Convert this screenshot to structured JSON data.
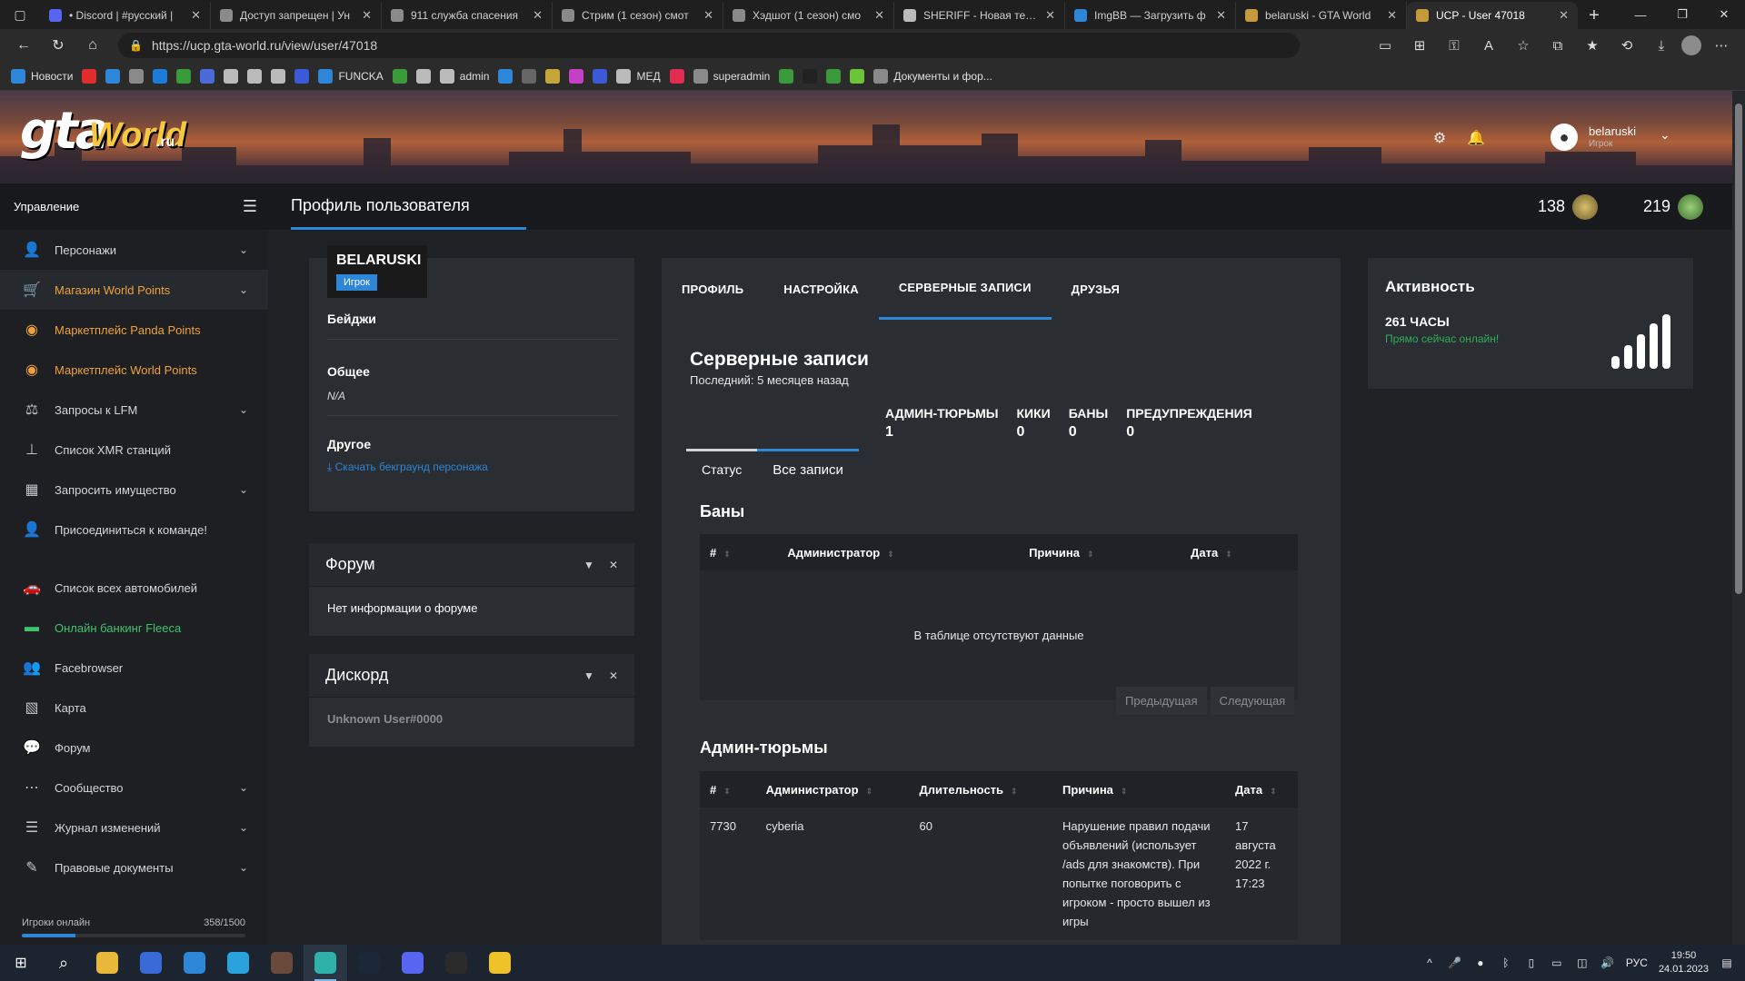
{
  "browser": {
    "tabs": [
      {
        "title": "• Discord | #русский | ",
        "fav": "#5865f2"
      },
      {
        "title": "Доступ запрещен | Ун",
        "fav": "#8a8a8a"
      },
      {
        "title": "911 служба спасения",
        "fav": "#8a8a8a"
      },
      {
        "title": "Стрим (1 сезон) смот",
        "fav": "#8a8a8a"
      },
      {
        "title": "Хэдшот (1 сезон) смо",
        "fav": "#8a8a8a"
      },
      {
        "title": "SHERIFF - Новая тема",
        "fav": "#bbbbbb"
      },
      {
        "title": "ImgBB — Загрузить ф",
        "fav": "#2d86d6"
      },
      {
        "title": "belaruski - GTA World",
        "fav": "#c59a3a"
      },
      {
        "title": "UCP - User 47018",
        "fav": "#c59a3a"
      }
    ],
    "url": "https://ucp.gta-world.ru/view/user/47018",
    "bookmarks": [
      {
        "label": "Новости",
        "color": "#2d86d6"
      },
      {
        "label": "",
        "color": "#e22b2b"
      },
      {
        "label": "",
        "color": "#2d86d6"
      },
      {
        "label": "",
        "color": "#8a8a8a"
      },
      {
        "label": "",
        "color": "#1c7ad8"
      },
      {
        "label": "",
        "color": "#3a9a3a"
      },
      {
        "label": "",
        "color": "#4a6ad8"
      },
      {
        "label": "",
        "color": "#bbbbbb"
      },
      {
        "label": "",
        "color": "#bbbbbb"
      },
      {
        "label": "",
        "color": "#bbbbbb"
      },
      {
        "label": "",
        "color": "#3a5ad8"
      },
      {
        "label": "FUNCKA",
        "color": "#2d86d6"
      },
      {
        "label": "",
        "color": "#3a9a3a"
      },
      {
        "label": "",
        "color": "#bbbbbb"
      },
      {
        "label": "admin",
        "color": "#bbbbbb"
      },
      {
        "label": "",
        "color": "#2d86d6"
      },
      {
        "label": "",
        "color": "#666666"
      },
      {
        "label": "",
        "color": "#c5a43a"
      },
      {
        "label": "",
        "color": "#c540c5"
      },
      {
        "label": "",
        "color": "#3a5ad8"
      },
      {
        "label": "МЕД",
        "color": "#bbbbbb"
      },
      {
        "label": "",
        "color": "#e22b50"
      },
      {
        "label": "superadmin",
        "color": "#8a8a8a"
      },
      {
        "label": "",
        "color": "#3a9a3a"
      },
      {
        "label": "",
        "color": "#222222"
      },
      {
        "label": "",
        "color": "#3a9a3a"
      },
      {
        "label": "",
        "color": "#6ac53a"
      },
      {
        "label": "Документы и фор...",
        "color": "#8a8a8a"
      }
    ]
  },
  "header": {
    "logo_main": "gta",
    "logo_sub": "World",
    "logo_ru": ".ru",
    "user_name": "belaruski",
    "user_role": "Игрок"
  },
  "sidebar": {
    "title": "Управление",
    "items": [
      {
        "label": "Персонажи",
        "icon": "person-icon",
        "glyph": "👤",
        "chev": true,
        "style": ""
      },
      {
        "label": "Магазин World Points",
        "icon": "cart-icon",
        "glyph": "🛒",
        "chev": true,
        "style": "orange active"
      },
      {
        "label": "Маркетплейс Panda Points",
        "icon": "coins-icon",
        "glyph": "◉",
        "chev": false,
        "style": "orange"
      },
      {
        "label": "Маркетплейс World Points",
        "icon": "coins-icon",
        "glyph": "◉",
        "chev": false,
        "style": "orange"
      },
      {
        "label": "Запросы к LFM",
        "icon": "scales-icon",
        "glyph": "⚖",
        "chev": true,
        "style": ""
      },
      {
        "label": "Список XMR станций",
        "icon": "antenna-icon",
        "glyph": "⊥",
        "chev": false,
        "style": ""
      },
      {
        "label": "Запросить имущество",
        "icon": "building-icon",
        "glyph": "▦",
        "chev": true,
        "style": ""
      },
      {
        "label": "Присоединиться к команде!",
        "icon": "person-add-icon",
        "glyph": "👤",
        "chev": false,
        "style": ""
      },
      {
        "label": "Список всех автомобилей",
        "icon": "car-icon",
        "glyph": "🚗",
        "chev": false,
        "style": "",
        "gap": true
      },
      {
        "label": "Онлайн банкинг Fleeca",
        "icon": "money-icon",
        "glyph": "▬",
        "chev": false,
        "style": "green"
      },
      {
        "label": "Facebrowser",
        "icon": "users-icon",
        "glyph": "👥",
        "chev": false,
        "style": ""
      },
      {
        "label": "Карта",
        "icon": "map-icon",
        "glyph": "▧",
        "chev": false,
        "style": ""
      },
      {
        "label": "Форум",
        "icon": "chat-icon",
        "glyph": "💬",
        "chev": false,
        "style": ""
      },
      {
        "label": "Сообщество",
        "icon": "share-icon",
        "glyph": "⋯",
        "chev": true,
        "style": ""
      },
      {
        "label": "Журнал изменений",
        "icon": "list-icon",
        "glyph": "☰",
        "chev": true,
        "style": ""
      },
      {
        "label": "Правовые документы",
        "icon": "document-icon",
        "glyph": "✎",
        "chev": true,
        "style": ""
      }
    ],
    "online_label": "Игроки онлайн",
    "online_value": "358/1500",
    "online_fraction": 0.239
  },
  "topstrip": {
    "page_title": "Профиль пользователя",
    "stat1": "138",
    "stat2": "219"
  },
  "profile": {
    "name": "BELARUSKI",
    "role": "Игрок",
    "badges_h": "Бейджи",
    "general_h": "Общее",
    "general_v": "N/A",
    "other_h": "Другое",
    "other_link": "Скачать бекграунд персонажа"
  },
  "forum": {
    "title": "Форум",
    "text": "Нет информации о форуме"
  },
  "discord": {
    "title": "Дискорд",
    "text": "Unknown User#0000"
  },
  "records": {
    "tabs": [
      "ПРОФИЛЬ",
      "НАСТРОЙКА",
      "СЕРВЕРНЫЕ ЗАПИСИ",
      "ДРУЗЬЯ"
    ],
    "title": "Серверные записи",
    "subtitle": "Последний: 5 месяцев назад",
    "counts": [
      {
        "label": "АДМИН-ТЮРЬМЫ",
        "value": "1"
      },
      {
        "label": "КИКИ",
        "value": "0"
      },
      {
        "label": "БАНЫ",
        "value": "0"
      },
      {
        "label": "ПРЕДУПРЕЖДЕНИЯ",
        "value": "0"
      }
    ],
    "subtabs": [
      "Статус",
      "Все записи"
    ],
    "bans_title": "Баны",
    "bans_headers": [
      "#",
      "Администратор",
      "Причина",
      "Дата"
    ],
    "bans_empty": "В таблице отсутствуют данные",
    "prev": "Предыдущая",
    "next": "Следующая",
    "jail_title": "Админ-тюрьмы",
    "jail_headers": [
      "#",
      "Администратор",
      "Длительность",
      "Причина",
      "Дата"
    ],
    "jail_rows": [
      [
        "7730",
        "cyberia",
        "60",
        "Нарушение правил подачи объявлений (использует /ads для знакомств). При попытке поговорить с игроком - просто вышел из игры",
        "17 августа 2022 г. 17:23"
      ]
    ]
  },
  "activity": {
    "title": "Активность",
    "hours": "261 ЧАСЫ",
    "online": "Прямо сейчас онлайн!"
  },
  "taskbar": {
    "apps": [
      {
        "icon": "search-icon",
        "color": "#1c2430"
      },
      {
        "icon": "folder-icon",
        "color": "#e8b83a"
      },
      {
        "icon": "app-icon",
        "color": "#3a6ad8"
      },
      {
        "icon": "vk-icon",
        "color": "#2d86d6"
      },
      {
        "icon": "telegram-icon",
        "color": "#2aa3dd"
      },
      {
        "icon": "game-icon",
        "color": "#6a4a3a"
      },
      {
        "icon": "edge-icon",
        "color": "#2fb0a8"
      },
      {
        "icon": "steam-icon",
        "color": "#1b2838"
      },
      {
        "icon": "discord-icon",
        "color": "#5865f2"
      },
      {
        "icon": "epic-icon",
        "color": "#2a2a2a"
      },
      {
        "icon": "rockstar-icon",
        "color": "#f0c22a"
      }
    ],
    "lang": "РУС",
    "time": "19:50",
    "date": "24.01.2023"
  }
}
